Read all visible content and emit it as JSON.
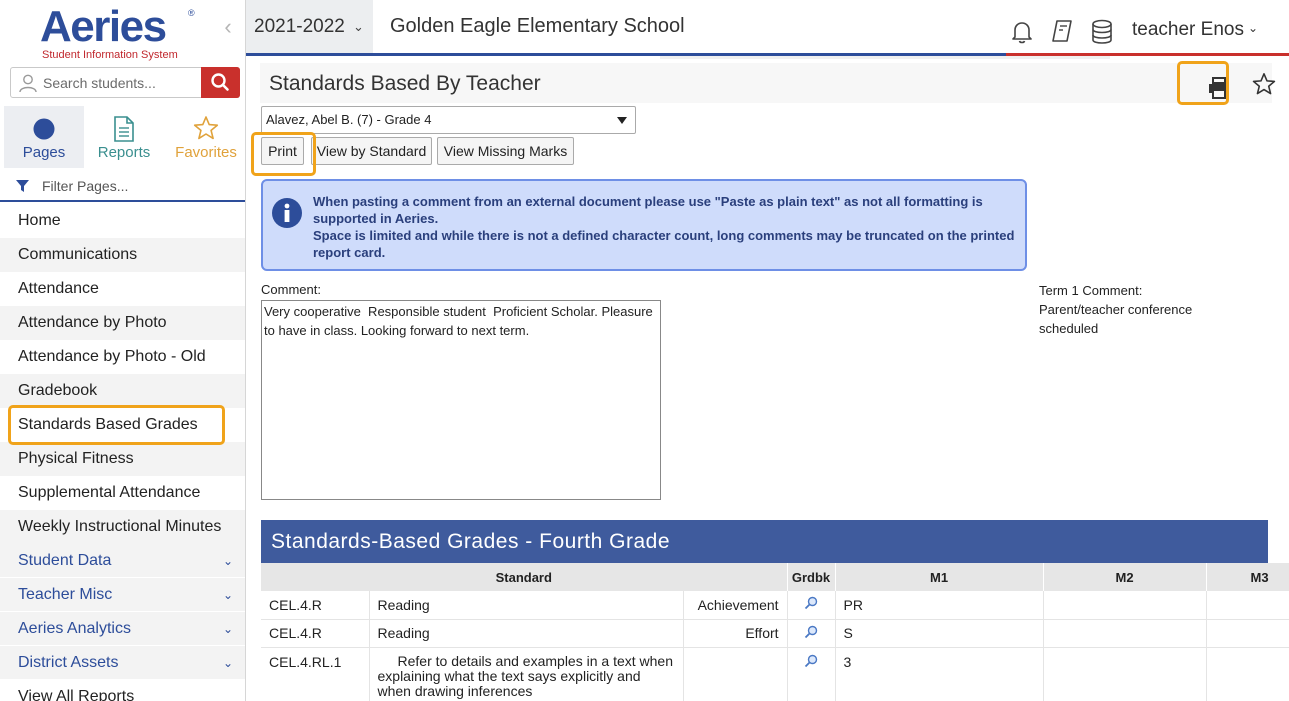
{
  "logo": {
    "name": "Aeries",
    "subtitle": "Student Information System"
  },
  "search": {
    "placeholder": "Search students..."
  },
  "nav_tabs": [
    {
      "label": "Pages"
    },
    {
      "label": "Reports"
    },
    {
      "label": "Favorites"
    }
  ],
  "filter": {
    "placeholder": "Filter Pages..."
  },
  "menu": {
    "items": [
      {
        "label": "Home"
      },
      {
        "label": "Communications"
      },
      {
        "label": "Attendance"
      },
      {
        "label": "Attendance by Photo"
      },
      {
        "label": "Attendance by Photo - Old"
      },
      {
        "label": "Gradebook"
      },
      {
        "label": "Standards Based Grades"
      },
      {
        "label": "Physical Fitness"
      },
      {
        "label": "Supplemental Attendance"
      },
      {
        "label": "Weekly Instructional Minutes"
      }
    ],
    "groups": [
      {
        "label": "Student Data"
      },
      {
        "label": "Teacher Misc"
      },
      {
        "label": "Aeries Analytics"
      },
      {
        "label": "District Assets"
      }
    ],
    "footer": "View All Reports"
  },
  "topbar": {
    "year": "2021-2022",
    "school": "Golden Eagle Elementary School",
    "user": "teacher Enos"
  },
  "page": {
    "title": "Standards Based By Teacher",
    "student": "Alavez, Abel B. (7) - Grade 4",
    "buttons": {
      "print": "Print",
      "by_standard": "View by Standard",
      "missing": "View Missing Marks"
    },
    "info_line1": "When pasting a comment from an external document please use \"Paste as plain text\" as not all formatting is supported in Aeries.",
    "info_line2": "Space is limited and while there is not a defined character count, long comments may be truncated on the printed report card.",
    "comment_label": "Comment:",
    "comment_value": "Very cooperative  Responsible student  Proficient Scholar. Pleasure to have in class. Looking forward to next term.",
    "term_comment_label": "Term 1 Comment:",
    "term_comment_value": "Parent/teacher conference scheduled"
  },
  "grades": {
    "title": "Standards-Based Grades - Fourth Grade",
    "headers": {
      "standard": "Standard",
      "grdbk": "Grdbk",
      "m1": "M1",
      "m2": "M2",
      "m3": "M3"
    },
    "rows": [
      {
        "code": "CEL.4.R",
        "standard": "Reading",
        "sub": "Achievement",
        "m1": "PR",
        "m2": "",
        "m3": ""
      },
      {
        "code": "CEL.4.R",
        "standard": "Reading",
        "sub": "Effort",
        "m1": "S",
        "m2": "",
        "m3": ""
      },
      {
        "code": "CEL.4.RL.1",
        "standard": "Refer to details and examples in a text when explaining what the text says explicitly and when drawing inferences",
        "sub": "",
        "m1": "3",
        "m2": "",
        "m3": ""
      }
    ]
  },
  "colors": {
    "brand": "#2d4d9a",
    "accent_red": "#c9302c",
    "highlight": "#f0a31a",
    "info_bg": "#cfdcfb"
  },
  "icons": [
    "search-icon",
    "person-icon",
    "circle-icon",
    "reports-icon",
    "star-icon",
    "filter-icon",
    "bell-icon",
    "book-icon",
    "database-icon",
    "printer-icon",
    "info-icon",
    "magnifier-icon",
    "chevron-down-icon",
    "chevron-left-icon"
  ]
}
